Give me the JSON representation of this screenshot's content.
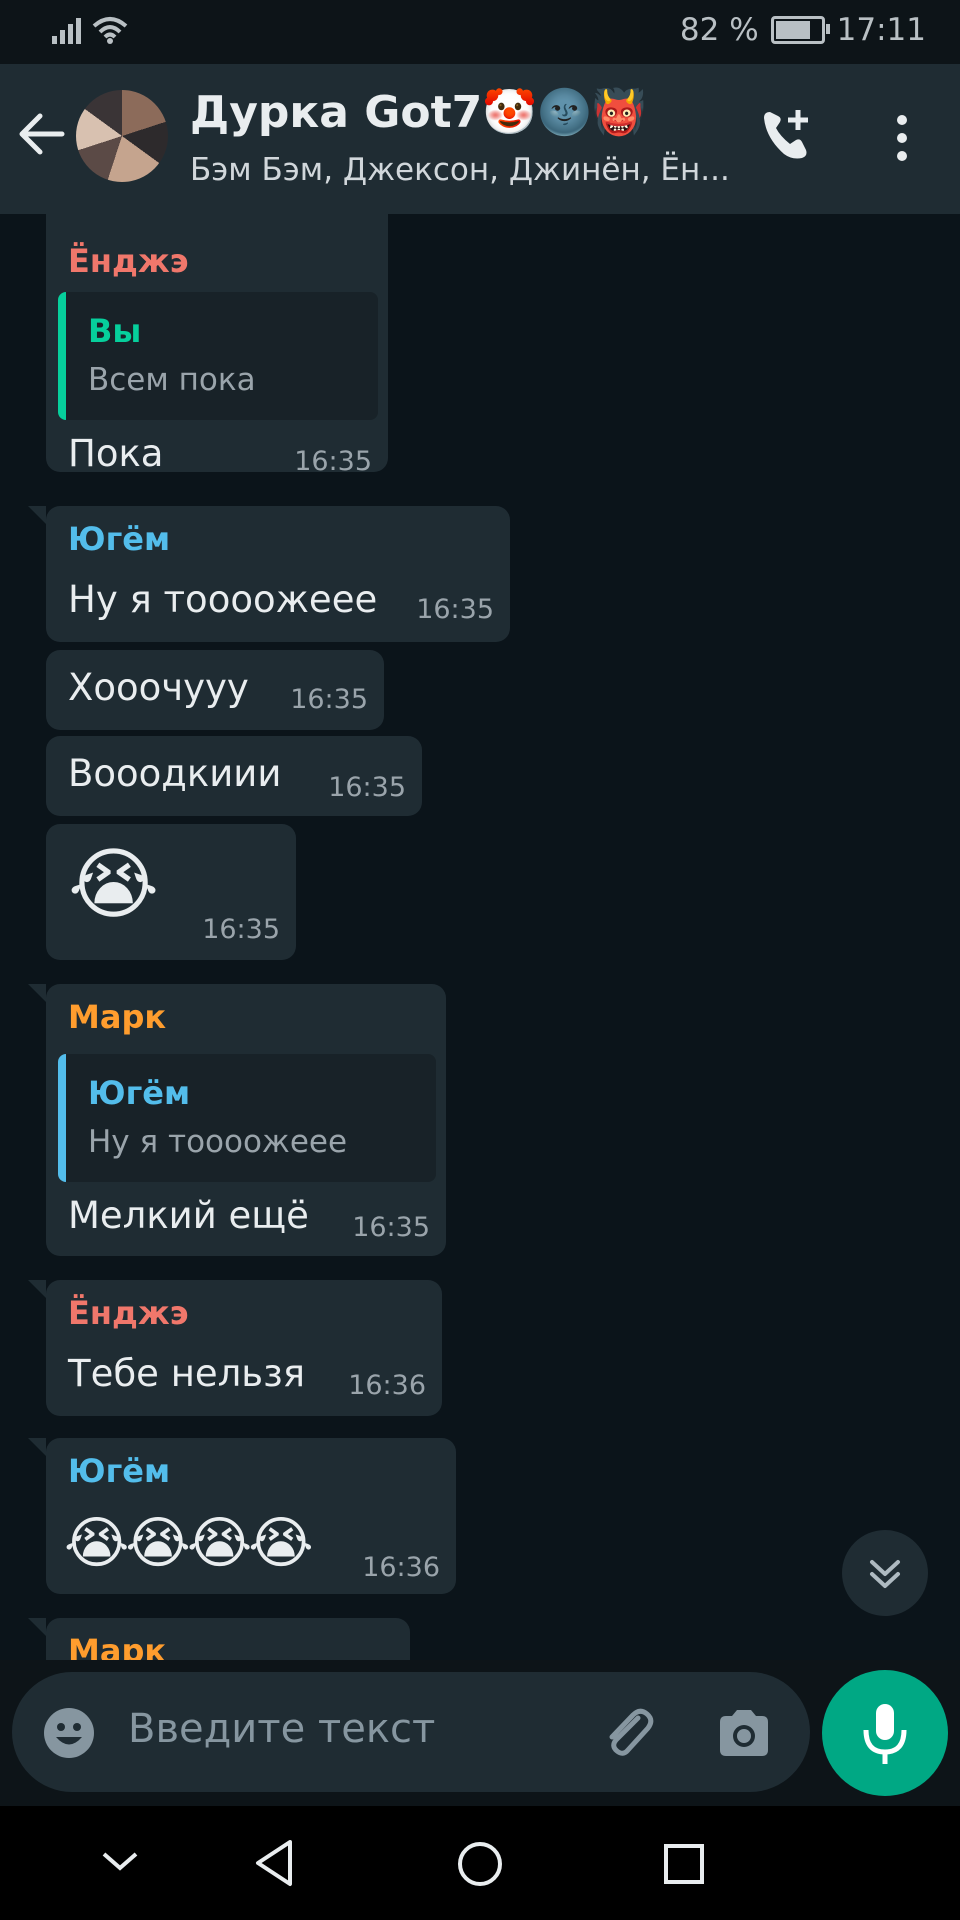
{
  "status_bar": {
    "battery": "82 %",
    "time": "17:11",
    "battery_level": 0.82
  },
  "header": {
    "title": "Дурка Got7",
    "title_emojis": "🤡🌚👹",
    "subtitle": "Бэм Бэм, Джексон, Джинён, Ён..."
  },
  "messages": [
    {
      "sender": "Ёнджэ",
      "quote_name": "Вы",
      "quote_text": "Всем пока",
      "text": "Пока",
      "time": "16:35"
    },
    {
      "sender": "Югём",
      "text": "Ну я тоооожеее",
      "time": "16:35"
    },
    {
      "text": "Хооочууу",
      "time": "16:35"
    },
    {
      "text": "Вооодкиии",
      "time": "16:35"
    },
    {
      "text": "😭",
      "time": "16:35"
    },
    {
      "sender": "Марк",
      "quote_name": "Югём",
      "quote_text": "Ну я тоооожеее",
      "text": "Мелкий ещё",
      "time": "16:35"
    },
    {
      "sender": "Ёнджэ",
      "text": "Тебе нельзя",
      "time": "16:36"
    },
    {
      "sender": "Югём",
      "text": "😭😭😭😭",
      "time": "16:36"
    },
    {
      "sender": "Марк"
    }
  ],
  "input": {
    "placeholder": "Введите текст"
  },
  "colors": {
    "youngjae": "#f0776b",
    "yugyeom": "#53bdeb",
    "mark": "#ff9d2e",
    "you": "#06cf9c",
    "mic": "#00a884"
  }
}
